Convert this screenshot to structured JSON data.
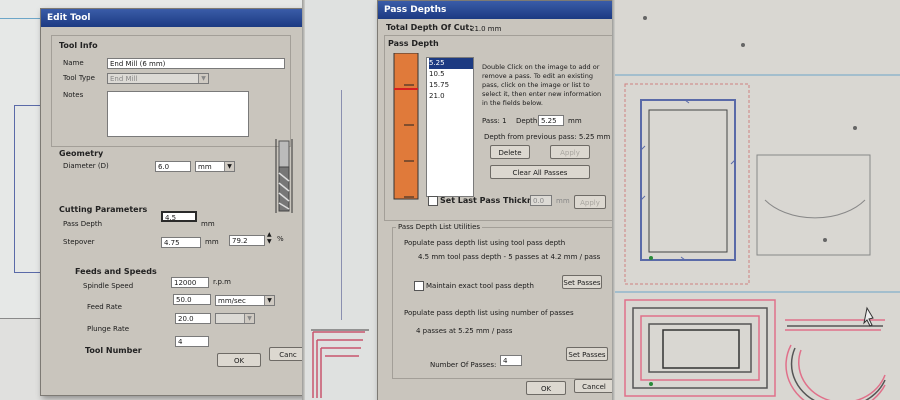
{
  "edit_tool": {
    "title": "Edit Tool",
    "tool_info": {
      "header": "Tool Info",
      "name_label": "Name",
      "name_value": "End Mill (6 mm)",
      "tool_type_label": "Tool Type",
      "tool_type_value": "End Mill",
      "notes_label": "Notes",
      "notes_value": ""
    },
    "geometry": {
      "header": "Geometry",
      "diameter_label": "Diameter (D)",
      "diameter_value": "6.0",
      "diameter_unit": "mm"
    },
    "cutting": {
      "header": "Cutting Parameters",
      "pass_depth_label": "Pass Depth",
      "pass_depth_value": "4.5",
      "pass_depth_unit": "mm",
      "stepover_label": "Stepover",
      "stepover_value": "4.75",
      "stepover_unit": "mm",
      "stepover_percent": "79.2",
      "percent_sign": "%"
    },
    "feeds": {
      "header": "Feeds and Speeds",
      "spindle_label": "Spindle Speed",
      "spindle_value": "12000",
      "spindle_unit": "r.p.m",
      "feed_label": "Feed Rate",
      "feed_value": "50.0",
      "feed_unit": "mm/sec",
      "plunge_label": "Plunge Rate",
      "plunge_value": "20.0"
    },
    "tool_number_label": "Tool Number",
    "tool_number_value": "4",
    "ok_label": "OK",
    "cancel_label": "Canc"
  },
  "pass_depths": {
    "title": "Pass Depths",
    "total_depth_label": "Total Depth Of Cut:",
    "total_depth_value": "21.0 mm",
    "section_header": "Pass Depth",
    "passes": [
      "5.25",
      "10.5",
      "15.75",
      "21.0"
    ],
    "help_text": "Double Click on the image to add or remove a pass. To edit an existing pass, click on the image or list to select it, then enter new information in the fields below.",
    "pass_label": "Pass: 1",
    "depth_label": "Depth:",
    "depth_value": "5.25",
    "depth_unit": "mm",
    "from_prev": "Depth from previous pass: 5.25 mm",
    "delete_label": "Delete",
    "apply_label": "Apply",
    "clear_all_label": "Clear All Passes",
    "last_pass_label": "Set Last Pass Thickness",
    "last_pass_value": "0.0",
    "last_pass_unit": "mm",
    "last_pass_apply": "Apply",
    "utilities_header": "Pass Depth List Utilities",
    "populate_tool_label": "Populate pass depth list using tool pass depth",
    "tool_summary": "4.5 mm tool pass depth - 5 passes at 4.2 mm / pass",
    "maintain_label": "Maintain exact tool pass depth",
    "set_passes_label": "Set Passes",
    "populate_number_label": "Populate pass depth list using number of passes",
    "number_summary": "4 passes at 5.25 mm / pass",
    "num_passes_label": "Number Of Passes:",
    "num_passes_value": "4",
    "set_passes2_label": "Set Passes",
    "ok_label": "OK",
    "cancel_label": "Cancel"
  },
  "colors": {
    "titlebar": "#1c3a82",
    "depth_bar": "#e07a3a",
    "depth_marker": "#d42020",
    "toolpath": "#5a6aa8",
    "vector_pink": "#e0708a"
  },
  "icons": [
    "end-mill-tool-icon",
    "dropdown-arrow-icon",
    "checkbox-icon",
    "spin-arrows-icon"
  ]
}
